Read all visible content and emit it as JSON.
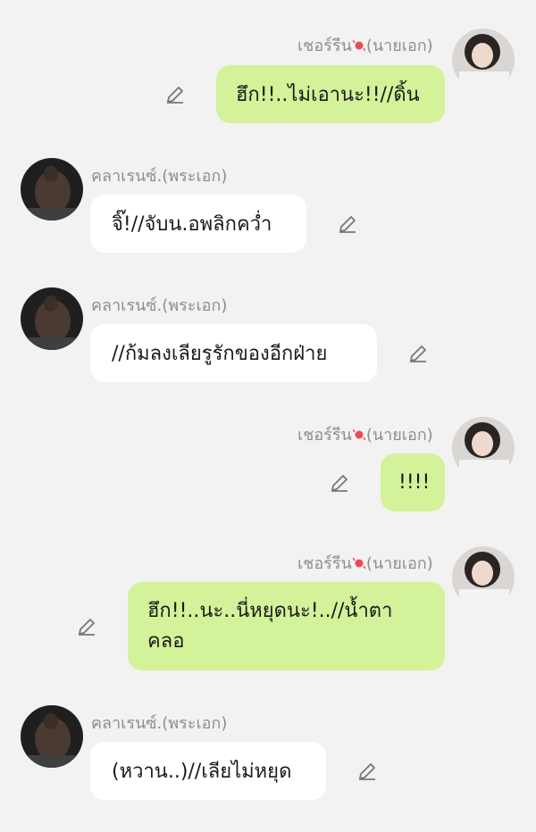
{
  "participants": {
    "right_name_before": "เชอร์รีน",
    "right_name_after": "(นายเอก)",
    "left_name": "คลาเรนซ์.(พระเอก)"
  },
  "messages": [
    {
      "side": "right",
      "text": "ฮึก!!..ไม่เอานะ!!//ดิ้น"
    },
    {
      "side": "left",
      "text": "จิ๊!//จับน.อพลิกคว่ำ"
    },
    {
      "side": "left",
      "text": "//ก้มลงเลียรูรักของอีกฝ่าย"
    },
    {
      "side": "right",
      "text": "!!!!"
    },
    {
      "side": "right",
      "text": "ฮึก!!..นะ..นี่หยุดนะ!..//น้ำตา\nคลอ"
    },
    {
      "side": "left",
      "text": "(หวาน..)//เลียไม่หยุด"
    }
  ],
  "icons": {
    "edit": "pencil-icon",
    "name_decoration": "candy-icon"
  },
  "colors": {
    "background": "#f2f2f2",
    "right_bubble": "#d4f29a",
    "left_bubble": "#ffffff",
    "name_text": "#8e8e8e"
  }
}
